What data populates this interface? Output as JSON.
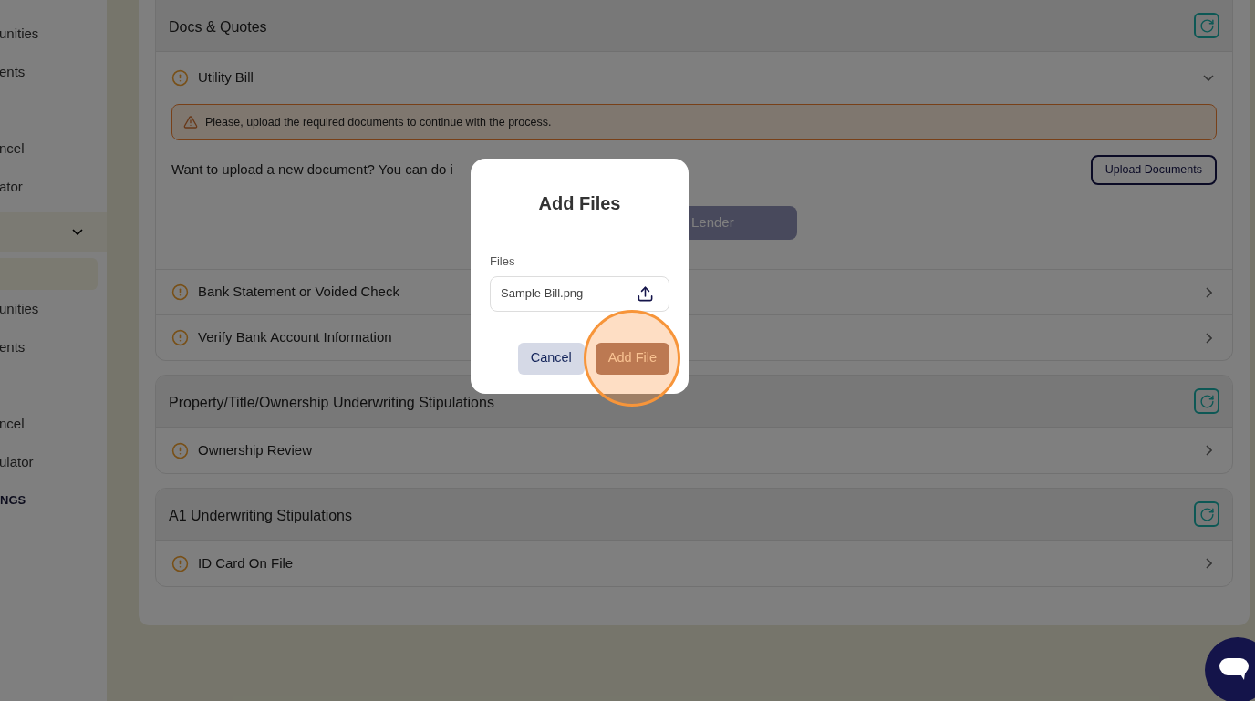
{
  "sidebar": {
    "items": [
      {
        "kind": "link",
        "label": "unities"
      },
      {
        "kind": "link",
        "label": "ents"
      },
      {
        "kind": "link",
        "label": "ncel"
      },
      {
        "kind": "link",
        "label": "ator"
      },
      {
        "kind": "group",
        "expanded": true
      },
      {
        "kind": "subitem",
        "selected": true
      },
      {
        "kind": "link",
        "label": "unities"
      },
      {
        "kind": "link",
        "label": "ents"
      },
      {
        "kind": "link",
        "label": "ncel"
      },
      {
        "kind": "link",
        "label": "ulator"
      },
      {
        "kind": "heading",
        "label": "NGS"
      }
    ]
  },
  "sections": [
    {
      "title": "Docs & Quotes",
      "items": [
        {
          "title": "Utility Bill",
          "expanded": true,
          "alert": "Please, upload the required documents to continue with the process.",
          "prompt": "Want to upload a new document? You can do i",
          "upload_button": "Upload Documents",
          "action_button": "Lender"
        },
        {
          "title": "Bank Statement or Voided Check",
          "expanded": false
        },
        {
          "title": "Verify Bank Account Information",
          "expanded": false
        }
      ]
    },
    {
      "title": "Property/Title/Ownership Underwriting Stipulations",
      "items": [
        {
          "title": "Ownership Review",
          "expanded": false
        }
      ]
    },
    {
      "title": "A1 Underwriting Stipulations",
      "items": [
        {
          "title": "ID Card On File",
          "expanded": false
        }
      ]
    }
  ],
  "modal": {
    "title": "Add Files",
    "field_label": "Files",
    "field_value": "Sample Bill.png",
    "buttons": [
      {
        "kind": "secondary",
        "label": "Cancel",
        "highlighted": false
      },
      {
        "kind": "primary",
        "label": "Add File",
        "highlighted": true
      }
    ]
  }
}
